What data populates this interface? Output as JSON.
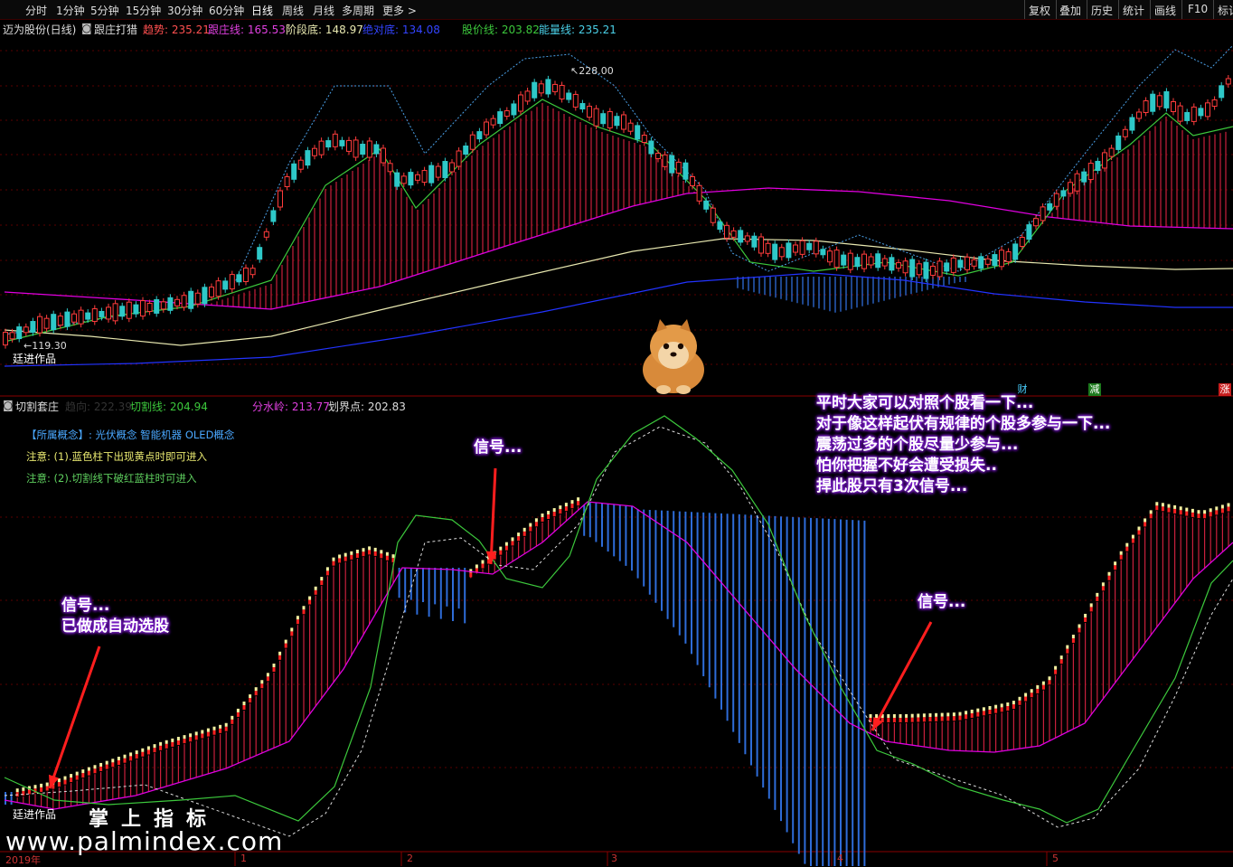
{
  "toolbar": {
    "periods": [
      "分时",
      "1分钟",
      "5分钟",
      "15分钟",
      "30分钟",
      "60分钟",
      "日线",
      "周线",
      "月线",
      "多周期",
      "更多 >"
    ],
    "active_period": "日线",
    "right_buttons": [
      "复权",
      "叠加",
      "历史",
      "统计",
      "画线",
      "F10",
      "标记"
    ]
  },
  "main_info": {
    "title": "迈为股份(日线)",
    "indicator": "跟庄打猎",
    "trend_label": "趋势: 235.21",
    "follow_label": "跟庄线: 165.53",
    "stage_label": "阶段底: 148.97",
    "absolute_label": "绝对底: 134.08",
    "price_label": "股价线: 203.82",
    "energy_label": "能量线: 235.21"
  },
  "main_chart": {
    "high_marker": "228.00",
    "low_marker": "119.30",
    "author": "廷进作品",
    "colors": {
      "trend_band": "#c8203c",
      "magenta": "#e000e0",
      "yellow": "#e8e8b0",
      "blue": "#2233ff",
      "green": "#3cc83c",
      "dash": "#4aa0e8",
      "cyan": "#2ec8c8"
    }
  },
  "flags": {
    "cai": "财",
    "jian": "减",
    "zhang": "涨"
  },
  "sub_info": {
    "title": "切割套庄",
    "dim_label": "趋向: 222.39",
    "cut_label": "切割线: 204.94",
    "water_label": "分水岭: 213.77",
    "line_label": "划界点: 202.83"
  },
  "sub_notes": {
    "concept": "【所属概念】: 光伏概念 智能机器 OLED概念",
    "note1": "注意: (1).蓝色柱下出现黄点时即可进入",
    "note2": "注意: (2).切割线下破红蓝柱时可进入"
  },
  "annotations": {
    "sig_left_1": "信号...",
    "sig_left_2": "已做成自动选股",
    "sig_mid": "信号...",
    "sig_right": "信号...",
    "text_lines": [
      "平时大家可以对照个股看一下...",
      "对于像这样起伏有规律的个股多参与一下...",
      "震荡过多的个股尽量少参与...",
      "怕你把握不好会遭受损失..",
      "捍此股只有3次信号..."
    ]
  },
  "bottom": {
    "author": "廷进作品",
    "brand": "掌上指标",
    "site": "www.palmindex.com",
    "x_labels": [
      "2019年",
      "1",
      "2",
      "3",
      "4",
      "5"
    ]
  }
}
